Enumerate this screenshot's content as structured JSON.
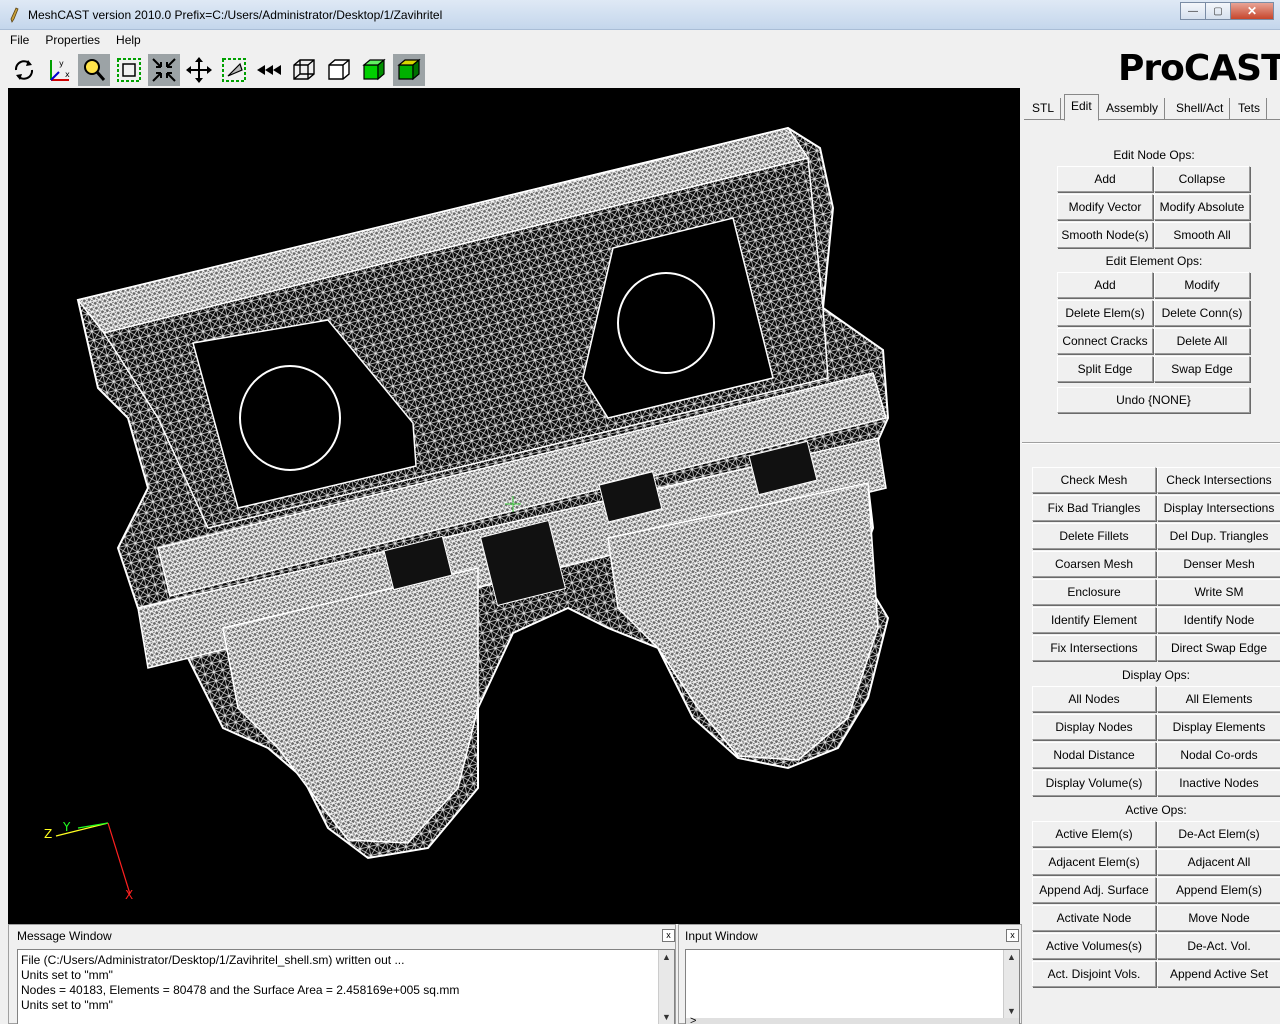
{
  "window": {
    "title": "MeshCAST version 2010.0    Prefix=C:/Users/Administrator/Desktop/1/Zavihritel",
    "minimize_glyph": "—",
    "maximize_glyph": "▢",
    "close_glyph": "✕"
  },
  "menu": [
    "File",
    "Properties",
    "Help"
  ],
  "toolbar": {
    "tools": [
      {
        "name": "rotate-tool-icon",
        "selected": false
      },
      {
        "name": "axes-tool-icon",
        "selected": false
      },
      {
        "name": "zoom-tool-icon",
        "selected": true
      },
      {
        "name": "zoom-box-tool-icon",
        "selected": false
      },
      {
        "name": "shrink-tool-icon",
        "selected": true
      },
      {
        "name": "pan-tool-icon",
        "selected": false
      },
      {
        "name": "clip-tool-icon",
        "selected": false
      },
      {
        "name": "rewind-tool-icon",
        "selected": false
      },
      {
        "name": "wireframe-cube-icon",
        "selected": false
      },
      {
        "name": "outline-cube-icon",
        "selected": false
      },
      {
        "name": "shaded-cube-icon",
        "selected": false
      },
      {
        "name": "solid-cube-icon",
        "selected": true
      }
    ]
  },
  "brand": "ProCAST",
  "viewport": {
    "axis_labels": {
      "z": "Z",
      "y": "Y",
      "x": "X"
    }
  },
  "tabs": [
    {
      "label": "STL",
      "active": false
    },
    {
      "label": "Edit",
      "active": true
    },
    {
      "label": "Assembly",
      "active": false
    },
    {
      "label": "Shell/Act",
      "active": false
    },
    {
      "label": "Tets",
      "active": false
    }
  ],
  "edit_node_ops": {
    "label": "Edit Node Ops:",
    "buttons": [
      [
        "Add",
        "Collapse"
      ],
      [
        "Modify Vector",
        "Modify Absolute"
      ],
      [
        "Smooth Node(s)",
        "Smooth All"
      ]
    ]
  },
  "edit_element_ops": {
    "label": "Edit Element Ops:",
    "buttons": [
      [
        "Add",
        "Modify"
      ],
      [
        "Delete Elem(s)",
        "Delete Conn(s)"
      ],
      [
        "Connect Cracks",
        "Delete All"
      ],
      [
        "Split Edge",
        "Swap Edge"
      ]
    ],
    "undo": "Undo {NONE}"
  },
  "mesh_ops": {
    "buttons": [
      [
        "Check Mesh",
        "Check Intersections"
      ],
      [
        "Fix Bad Triangles",
        "Display Intersections"
      ],
      [
        "Delete Fillets",
        "Del Dup. Triangles"
      ],
      [
        "Coarsen Mesh",
        "Denser Mesh"
      ],
      [
        "Enclosure",
        "Write SM"
      ],
      [
        "Identify Element",
        "Identify Node"
      ],
      [
        "Fix Intersections",
        "Direct Swap Edge"
      ]
    ]
  },
  "display_ops": {
    "label": "Display Ops:",
    "buttons": [
      [
        "All Nodes",
        "All Elements"
      ],
      [
        "Display Nodes",
        "Display Elements"
      ],
      [
        "Nodal Distance",
        "Nodal Co-ords"
      ],
      [
        "Display Volume(s)",
        "Inactive Nodes"
      ]
    ]
  },
  "active_ops": {
    "label": "Active Ops:",
    "buttons": [
      [
        "Active Elem(s)",
        "De-Act Elem(s)"
      ],
      [
        "Adjacent Elem(s)",
        "Adjacent All"
      ],
      [
        "Append Adj. Surface",
        "Append Elem(s)"
      ],
      [
        "Activate Node",
        "Move Node"
      ],
      [
        "Active Volumes(s)",
        "De-Act. Vol."
      ],
      [
        "Act. Disjoint Vols.",
        "Append Active Set"
      ]
    ]
  },
  "message_window": {
    "title": "Message Window",
    "close": "x",
    "lines": [
      "File (C:/Users/Administrator/Desktop/1/Zavihritel_shell.sm) written out ...",
      "Units set to \"mm\"",
      "Nodes = 40183,  Elements = 80478 and the Surface Area = 2.458169e+005 sq.mm",
      "Units set to \"mm\""
    ]
  },
  "input_window": {
    "title": "Input Window",
    "close": "x",
    "prompt": ">"
  },
  "colors": {
    "viewport_bg": "#000000",
    "mesh": "#ffffff",
    "axis_x": "#ff2020",
    "axis_y": "#20ff20",
    "axis_z": "#ffff20"
  }
}
